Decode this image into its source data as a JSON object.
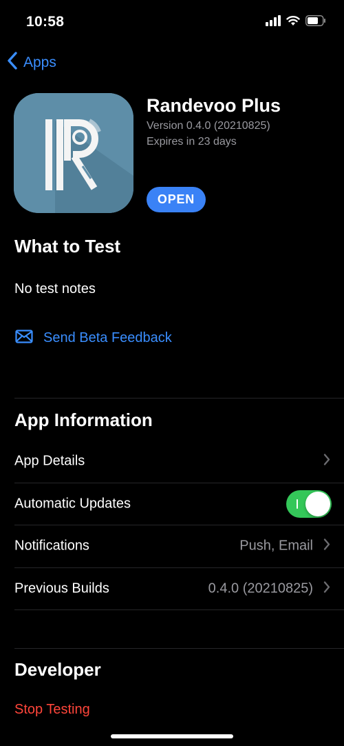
{
  "status_bar": {
    "time": "10:58"
  },
  "nav": {
    "back_label": "Apps"
  },
  "app": {
    "name": "Randevoo Plus",
    "version": "Version 0.4.0 (20210825)",
    "expires": "Expires in 23 days",
    "open_label": "OPEN"
  },
  "what_to_test": {
    "title": "What to Test",
    "notes": "No test notes",
    "feedback_label": "Send Beta Feedback"
  },
  "app_information": {
    "title": "App Information",
    "rows": [
      {
        "label": "App Details",
        "value": ""
      },
      {
        "label": "Automatic Updates",
        "toggle_on": true
      },
      {
        "label": "Notifications",
        "value": "Push, Email"
      },
      {
        "label": "Previous Builds",
        "value": "0.4.0 (20210825)"
      }
    ]
  },
  "developer": {
    "title": "Developer",
    "stop_label": "Stop Testing"
  },
  "colors": {
    "accent": "#3a8eff",
    "destructive": "#ff453a",
    "toggle_on": "#34c759",
    "secondary_text": "#9a9aa0"
  }
}
